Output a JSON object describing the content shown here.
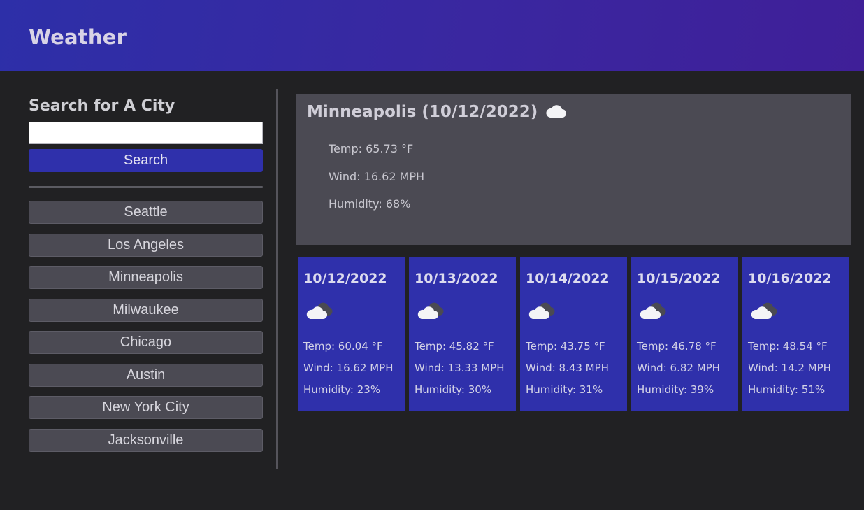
{
  "header": {
    "title": "Weather"
  },
  "sidebar": {
    "heading": "Search for A City",
    "search_value": "",
    "search_button": "Search",
    "history": [
      "Seattle",
      "Los Angeles",
      "Minneapolis",
      "Milwaukee",
      "Chicago",
      "Austin",
      "New York City",
      "Jacksonville"
    ]
  },
  "current": {
    "title": "Minneapolis (10/12/2022)",
    "icon": "cloud-icon",
    "temp": "Temp: 65.73 °F",
    "wind": "Wind: 16.62 MPH",
    "humidity": "Humidity: 68%"
  },
  "forecast": [
    {
      "date": "10/12/2022",
      "icon": "cloud-icon",
      "temp": "Temp: 60.04 °F",
      "wind": "Wind: 16.62 MPH",
      "humidity": "Humidity: 23%"
    },
    {
      "date": "10/13/2022",
      "icon": "cloud-icon",
      "temp": "Temp: 45.82 °F",
      "wind": "Wind: 13.33 MPH",
      "humidity": "Humidity: 30%"
    },
    {
      "date": "10/14/2022",
      "icon": "cloud-icon",
      "temp": "Temp: 43.75 °F",
      "wind": "Wind: 8.43 MPH",
      "humidity": "Humidity: 31%"
    },
    {
      "date": "10/15/2022",
      "icon": "cloud-icon",
      "temp": "Temp: 46.78 °F",
      "wind": "Wind: 6.82 MPH",
      "humidity": "Humidity: 39%"
    },
    {
      "date": "10/16/2022",
      "icon": "cloud-icon",
      "temp": "Temp: 48.54 °F",
      "wind": "Wind: 14.2 MPH",
      "humidity": "Humidity: 51%"
    }
  ],
  "colors": {
    "header": "#2d2fa8",
    "accent": "#2f30ab",
    "panel": "#4b4a53",
    "background": "#212123"
  }
}
